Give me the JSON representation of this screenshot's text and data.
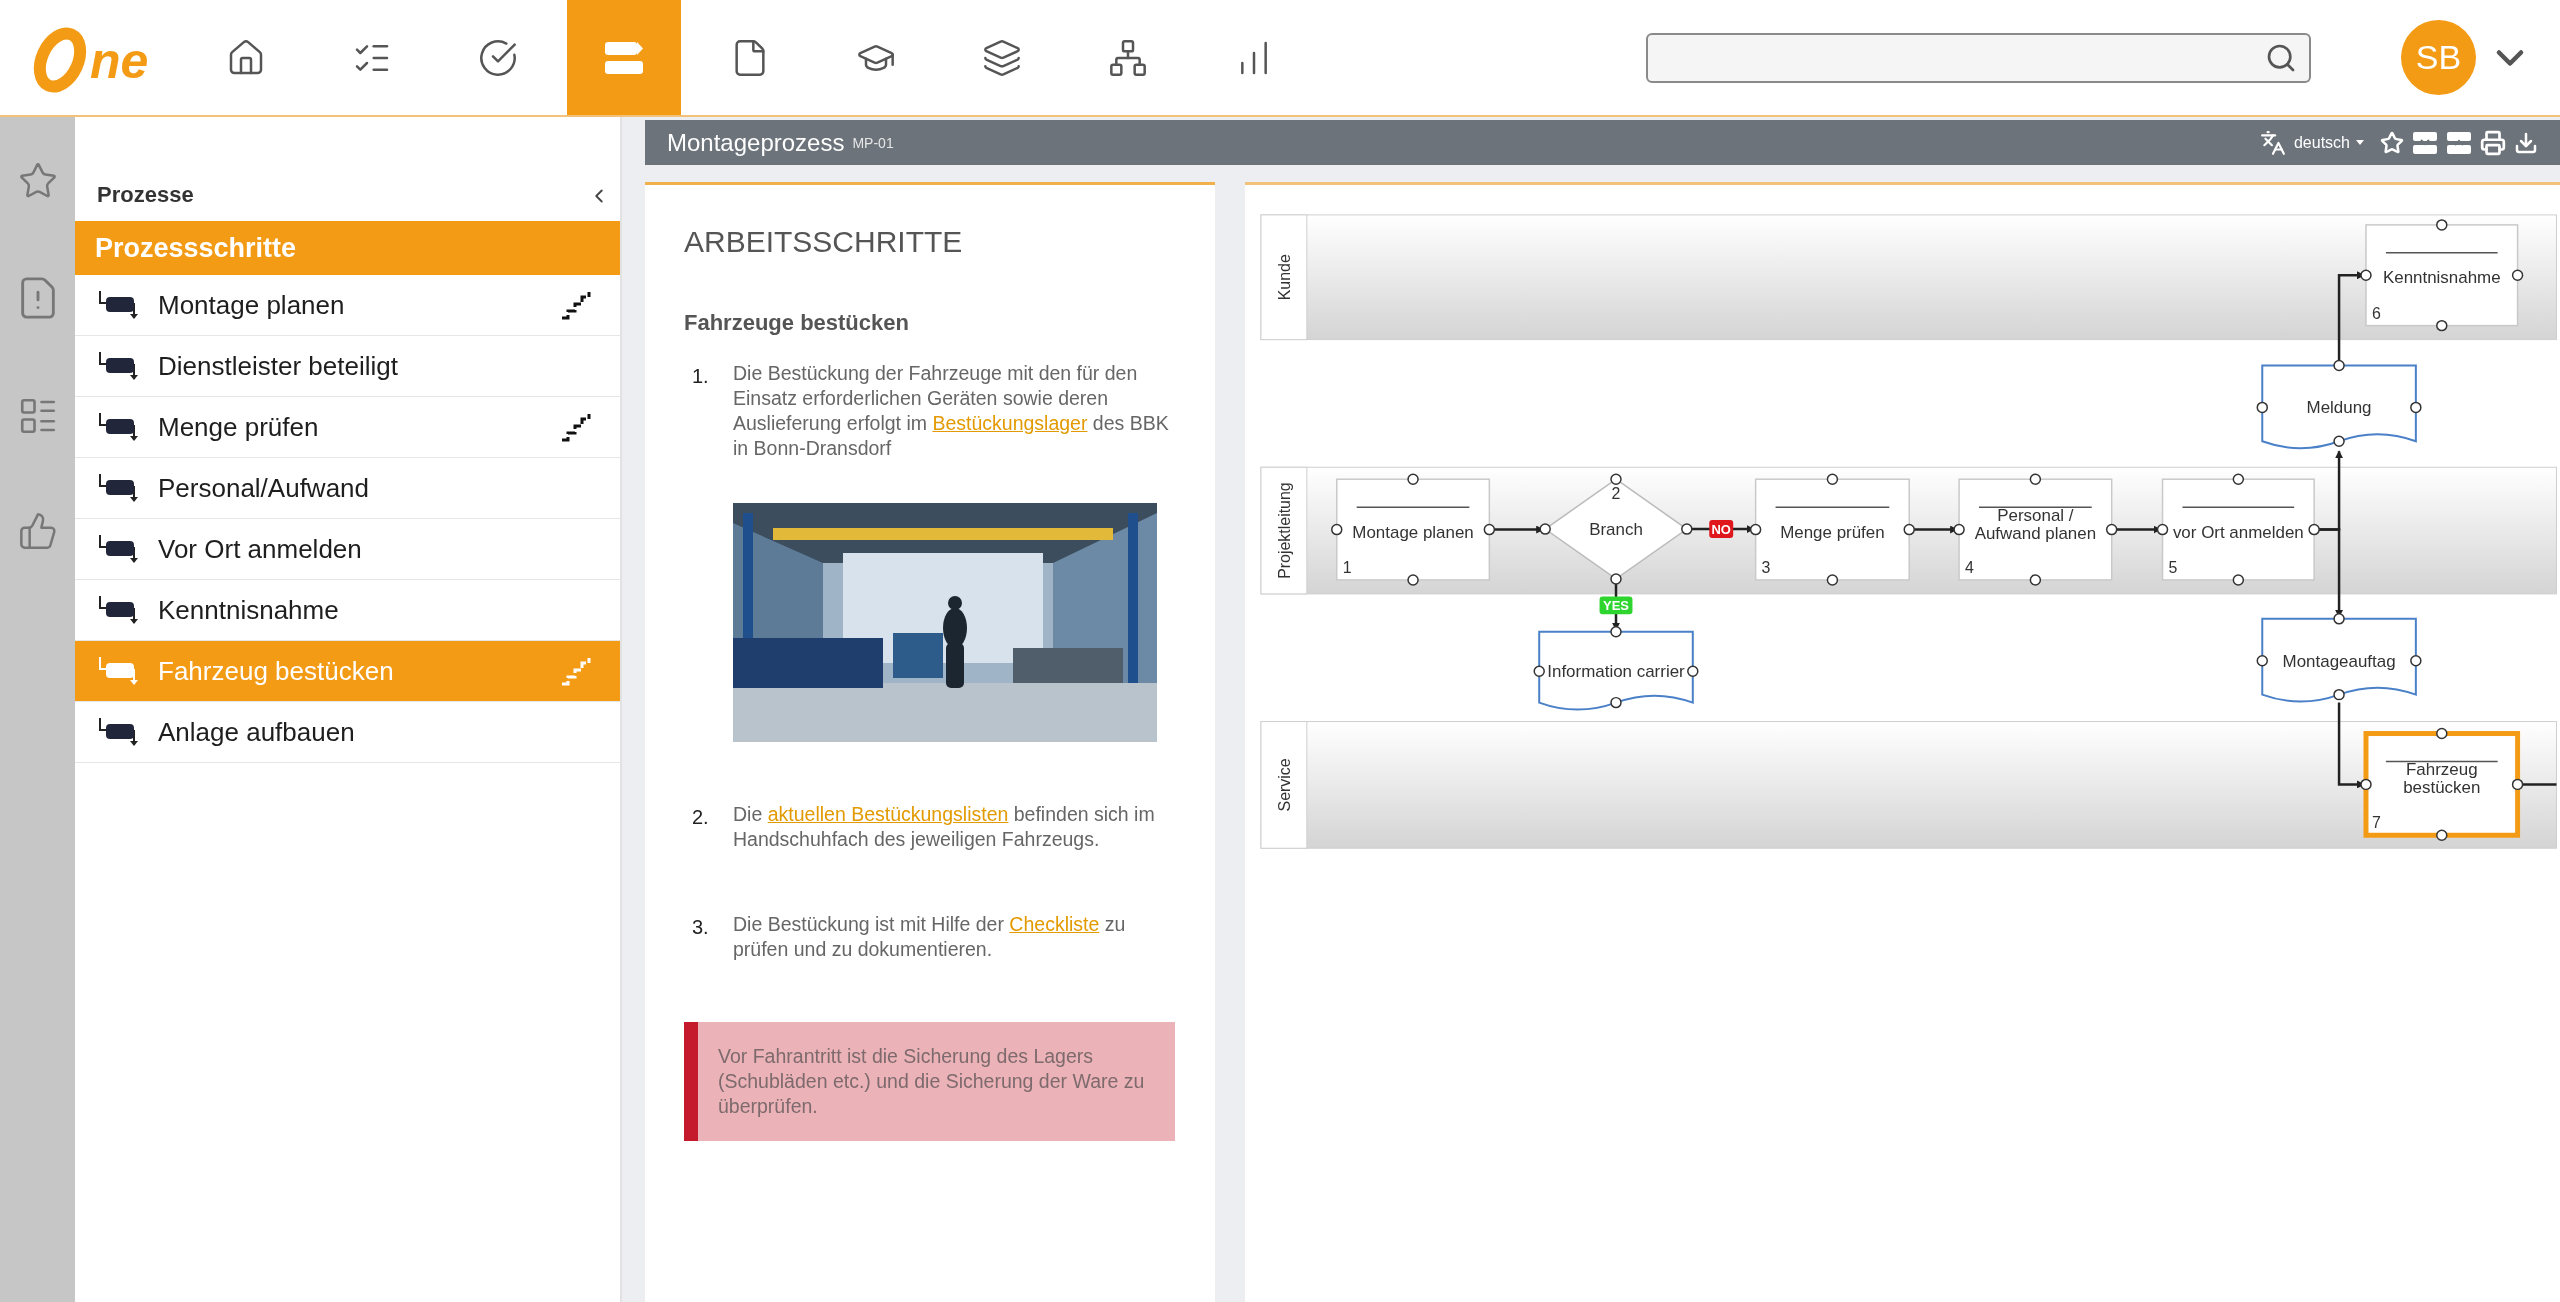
{
  "top_bar": {
    "logo": {
      "text": "ne"
    },
    "nav": [
      {
        "selected": false
      },
      {
        "selected": false
      },
      {
        "selected": false
      },
      {
        "selected": true
      },
      {
        "selected": false
      },
      {
        "selected": false
      },
      {
        "selected": false
      },
      {
        "selected": false
      },
      {
        "selected": false
      }
    ],
    "user": {
      "initials": "SB"
    }
  },
  "sidebar": {
    "title": "Prozesse",
    "section": "Prozessschritte",
    "items": [
      {
        "label": "Montage planen",
        "selected": false,
        "has_subprocess": true
      },
      {
        "label": "Dienstleister beteiligt",
        "selected": false,
        "has_subprocess": false
      },
      {
        "label": "Menge prüfen",
        "selected": false,
        "has_subprocess": true
      },
      {
        "label": "Personal/Aufwand",
        "selected": false,
        "has_subprocess": false
      },
      {
        "label": "Vor Ort anmelden",
        "selected": false,
        "has_subprocess": false
      },
      {
        "label": "Kenntnisnahme",
        "selected": false,
        "has_subprocess": false
      },
      {
        "label": "Fahrzeug bestücken",
        "selected": true,
        "has_subprocess": true
      },
      {
        "label": "Anlage aufbauen",
        "selected": false,
        "has_subprocess": false
      }
    ]
  },
  "document": {
    "title": "Montageprozess",
    "code": "MP-01",
    "language": "deutsch"
  },
  "content": {
    "heading": "ARBEITSSCHRITTE",
    "subheading": "Fahrzeuge bestücken",
    "steps": [
      {
        "number": "1.",
        "parts": [
          {
            "text": "Die Bestückung der Fahrzeuge mit den für den Einsatz erforderlichen Geräten sowie deren Auslieferung erfolgt im "
          },
          {
            "link": "Bestückungslager"
          },
          {
            "text": " des BBK in Bonn-Dransdorf"
          }
        ]
      },
      {
        "number": "2.",
        "parts": [
          {
            "text": "Die "
          },
          {
            "link": "aktuellen Bestückungslisten"
          },
          {
            "text": " befinden sich im Handschuhfach des jeweiligen Fahrzeugs."
          }
        ]
      },
      {
        "number": "3.",
        "parts": [
          {
            "text": "Die Bestückung ist mit Hilfe der "
          },
          {
            "link": "Checkliste"
          },
          {
            "text": " zu prüfen und zu dokumentieren."
          }
        ]
      }
    ],
    "alert": "Vor Fahrantritt ist die Sicherung des Lagers (Schubläden etc.) und die Sicherung der Ware zu überprüfen."
  },
  "diagram": {
    "lanes": [
      {
        "label": "Kunde"
      },
      {
        "label": "Projektleitung"
      },
      {
        "label": "Service"
      }
    ],
    "nodes": [
      {
        "kind": "task",
        "label": "Montage planen",
        "number": "1",
        "selected": false
      },
      {
        "kind": "decision",
        "label": "Branch",
        "number": "2",
        "selected": false
      },
      {
        "kind": "task",
        "label": "Menge prüfen",
        "number": "3",
        "selected": false
      },
      {
        "kind": "task",
        "label": "Personal /\nAufwand planen",
        "number": "4",
        "selected": false
      },
      {
        "kind": "task",
        "label": "vor Ort anmelden",
        "number": "5",
        "selected": false
      },
      {
        "kind": "task",
        "label": "Kenntnisnahme",
        "number": "6",
        "selected": false
      },
      {
        "kind": "task",
        "label": "Fahrzeug\nbestücken",
        "number": "7",
        "selected": true
      },
      {
        "kind": "document",
        "label": "Information carrier",
        "selected": false
      },
      {
        "kind": "document",
        "label": "Meldung",
        "selected": false
      },
      {
        "kind": "document",
        "label": "Montageauftag",
        "selected": false
      }
    ],
    "edge_labels": [
      {
        "text": "NO",
        "kind": "no"
      },
      {
        "text": "YES",
        "kind": "yes"
      }
    ]
  }
}
